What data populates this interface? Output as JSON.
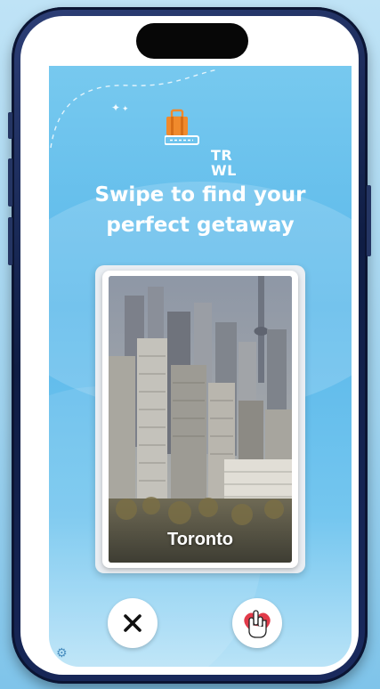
{
  "app": {
    "logo_line1": "TR",
    "logo_line2": "WL",
    "headline_line1": "Swipe to find your",
    "headline_line2": "perfect getaway"
  },
  "card": {
    "city": "Toronto"
  },
  "actions": {
    "dislike_icon": "close-x-icon",
    "like_icon": "hand-heart-icon"
  },
  "colors": {
    "screen_bg": "#5ab8ea",
    "suitcase": "#f08a2c",
    "like_heart": "#e23b4a",
    "phone_frame": "#1a2a5e"
  }
}
